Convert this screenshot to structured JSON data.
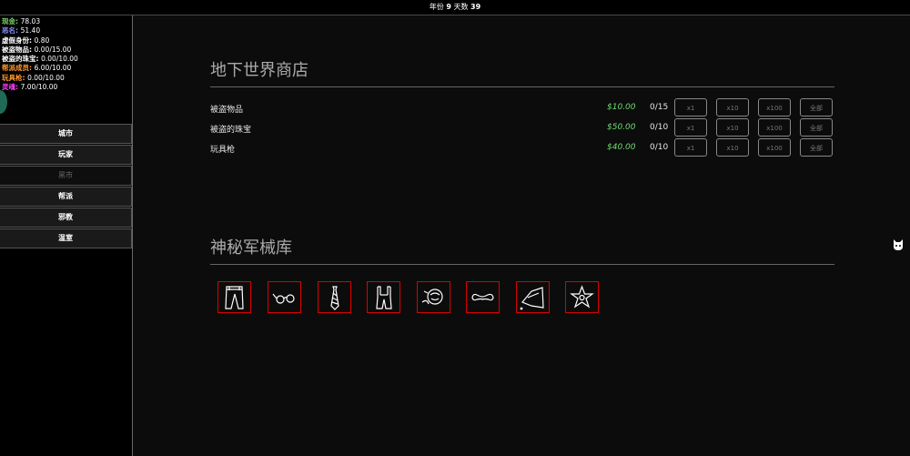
{
  "topbar": {
    "year_label": "年份",
    "year": "9",
    "days_label": "天数",
    "days": "39"
  },
  "stats": [
    {
      "label": "现金:",
      "value": "78.03",
      "color": "#7bd36b"
    },
    {
      "label": "恶名:",
      "value": "51.40",
      "color": "#8c8cff"
    },
    {
      "label": "虚假身份:",
      "value": "0.80",
      "color": "#ffffff"
    },
    {
      "label": "被盗物品:",
      "value": "0.00/15.00",
      "color": "#ffffff"
    },
    {
      "label": "被盗的珠宝:",
      "value": "0.00/10.00",
      "color": "#ffffff"
    },
    {
      "label": "帮派成员:",
      "value": "6.00/10.00",
      "color": "#ff9a2e"
    },
    {
      "label": "玩具枪:",
      "value": "0.00/10.00",
      "color": "#ff9a2e"
    },
    {
      "label": "灵魂:",
      "value": "7.00/10.00",
      "color": "#ff44ff"
    }
  ],
  "nav": [
    {
      "label": "城市",
      "enabled": true
    },
    {
      "label": "玩家",
      "enabled": true
    },
    {
      "label": "黑市",
      "enabled": false
    },
    {
      "label": "帮派",
      "enabled": true
    },
    {
      "label": "邪教",
      "enabled": true
    },
    {
      "label": "温室",
      "enabled": true
    }
  ],
  "shop": {
    "title": "地下世界商店",
    "buttons": [
      "x1",
      "x10",
      "x100",
      "全部"
    ],
    "items": [
      {
        "name": "被盗物品",
        "price": "$10.00",
        "qty": "0/15"
      },
      {
        "name": "被盗的珠宝",
        "price": "$50.00",
        "qty": "0/10"
      },
      {
        "name": "玩具枪",
        "price": "$40.00",
        "qty": "0/10"
      }
    ]
  },
  "armory": {
    "title": "神秘军械库",
    "items": [
      "pants-icon",
      "glasses-icon",
      "tie-icon",
      "overalls-icon",
      "face-icon",
      "mustache-icon",
      "iron-icon",
      "sheriff-star-icon"
    ]
  },
  "colors": {
    "price": "#6fdc6f",
    "aug_border": "#dd0000",
    "accent_circle": "#1f6b57"
  }
}
